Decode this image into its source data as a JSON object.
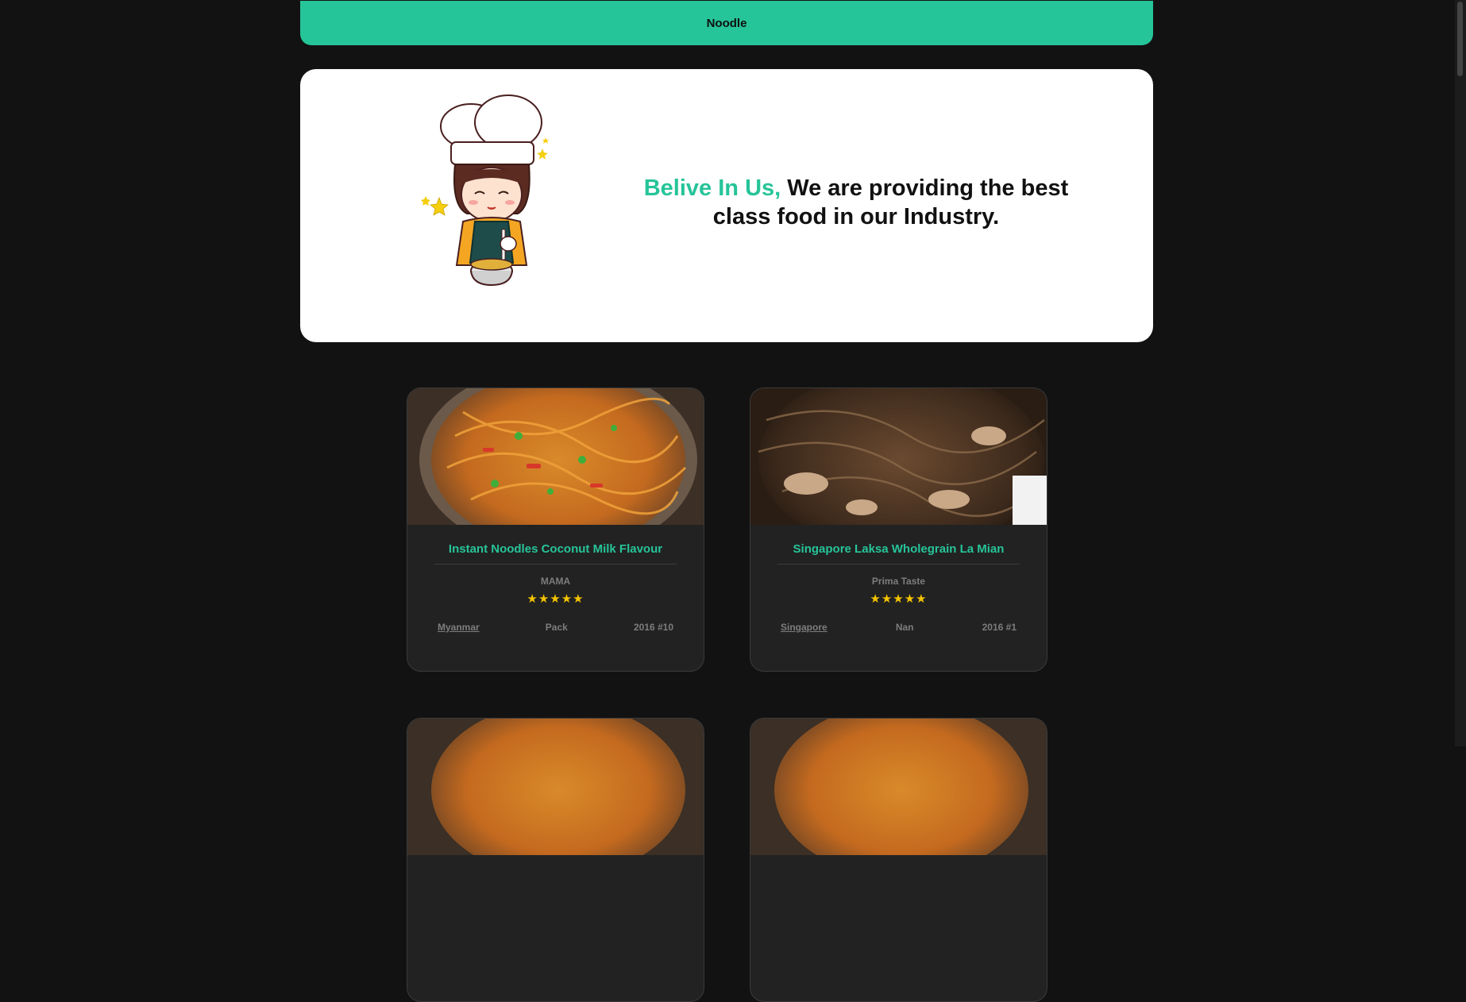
{
  "header": {
    "title": "Noodle"
  },
  "hero": {
    "highlight": "Belive In Us,",
    "line1": " We are providing the best",
    "line2": "class food in our Industry."
  },
  "colors": {
    "accent": "#26c499",
    "background": "#121212",
    "card": "#222222",
    "star": "#f4c400"
  },
  "cards": [
    {
      "title": "Instant Noodles Coconut Milk Flavour",
      "brand": "MAMA",
      "stars": "★★★★★",
      "country": "Myanmar",
      "style": "Pack",
      "top_ten": "2016 #10",
      "image": "noodle-dish-photo"
    },
    {
      "title": "Singapore Laksa Wholegrain La Mian",
      "brand": "Prima Taste",
      "stars": "★★★★★",
      "country": "Singapore",
      "style": "Nan",
      "top_ten": "2016 #1",
      "image": "noodle-dish-photo"
    }
  ]
}
